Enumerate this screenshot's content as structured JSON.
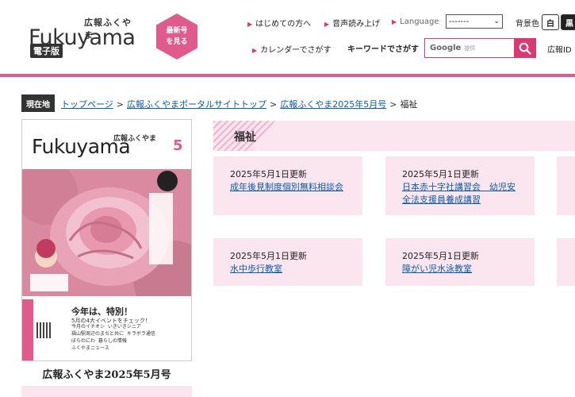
{
  "header": {
    "logo_small": "広報ふくやま",
    "logo_main": "Fukuyama",
    "logo_badge": "電子版",
    "hex_line1": "最新号",
    "hex_line2": "を見る",
    "nav": {
      "first_time": "はじめての方へ",
      "voice": "音声読み上げ",
      "language": "Language",
      "calendar": "カレンダーでさがす"
    },
    "language_select": "-------",
    "bgcolor_label": "背景色",
    "bg_white": "白",
    "bg_black": "黒",
    "keyword_label": "キーワードでさがす",
    "search_google": "Google",
    "search_provided": "提供",
    "koho_id": "広報ID"
  },
  "breadcrumb": {
    "label": "現在地",
    "items": [
      "トップページ",
      "広報ふくやまポータルサイトトップ",
      "広報ふくやま2025年5月号"
    ],
    "current": "福祉"
  },
  "cover": {
    "small": "広報ふくやま",
    "title": "Fukuyama",
    "issue_number": "5",
    "headline": "今年は、特別！",
    "subhead": "5月の4大イベントをチェック！",
    "list": [
      "今月のイチオシ",
      "福山駅周辺のまちと共に",
      "ぼらのにわ",
      "いきいきシニア",
      "キラボラ通信",
      "暮らしの情報",
      "ふくやまニュース"
    ],
    "caption": "広報ふくやま2025年5月号"
  },
  "category": {
    "title": "福祉"
  },
  "cards": [
    {
      "date": "2025年5月1日更新",
      "title": "成年後見制度個別無料相談会"
    },
    {
      "date": "2025年5月1日更新",
      "title": "日本赤十字社講習会　幼児安全法支援員養成講習"
    },
    {
      "date": "2025年5月1日更新",
      "title": "水中歩行教室"
    },
    {
      "date": "2025年5月1日更新",
      "title": "障がい児水泳教室"
    }
  ],
  "colors": {
    "accent": "#d83a72",
    "pink_line": "#e05a8c",
    "card_bg": "#fbe5ee",
    "link": "#0b5cad"
  }
}
